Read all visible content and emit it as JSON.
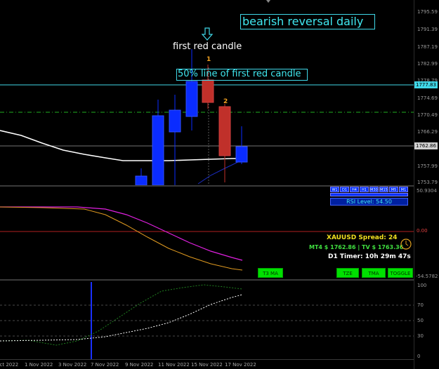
{
  "annotations": {
    "title": "bearish reversal daily",
    "first_red": "first red candle",
    "fifty_line": "50% line of first red candle",
    "marker_1": "1",
    "marker_2": "2"
  },
  "price_axis": [
    "1795.59",
    "1791.39",
    "1787.19",
    "1782.99",
    "1778.79",
    "1774.69",
    "1770.49",
    "1766.29",
    "1762.09",
    "1757.99",
    "1753.79"
  ],
  "price_tags": {
    "current": "1762.86",
    "fifty": "1777.83"
  },
  "indicator": {
    "top_value": "50.9304",
    "zero_value": "0.00",
    "bottom_value": "-54.5782",
    "rsi_label": "RSI Level:",
    "rsi_value": "54.50",
    "timeframes": [
      "W1",
      "D1",
      "H4",
      "H1",
      "M30",
      "M15",
      "M5",
      "M1"
    ]
  },
  "info": {
    "spread": "XAUUSD Spread: 24",
    "prices": "MT4 $ 1762.86 | TV $ 1763.36",
    "timer": "D1 Timer: 10h 29m 47s"
  },
  "buttons": {
    "t3ma": "T3 MA",
    "tze": "TZE",
    "tma": "TMA",
    "toggle": "TOGGLE"
  },
  "oscillator_axis": [
    "100",
    "70",
    "50",
    "30",
    "0"
  ],
  "x_axis": [
    "Oct 2022",
    "1 Nov 2022",
    "3 Nov 2022",
    "7 Nov 2022",
    "9 Nov 2022",
    "11 Nov 2022",
    "15 Nov 2022",
    "17 Nov 2022"
  ],
  "colors": {
    "bull": "#0a2cff",
    "bear": "#c0302a",
    "cyan": "#40e8f0",
    "green_btn": "#00e000",
    "magenta": "#e020e0",
    "orange": "#e09a20"
  }
}
